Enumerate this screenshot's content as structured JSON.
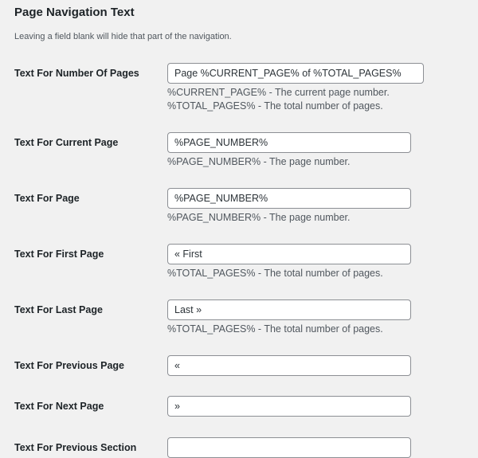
{
  "section": {
    "title": "Page Navigation Text",
    "description": "Leaving a field blank will hide that part of the navigation."
  },
  "fields": [
    {
      "label": "Text For Number Of Pages",
      "value": "Page %CURRENT_PAGE% of %TOTAL_PAGES%",
      "descriptions": [
        "%CURRENT_PAGE% - The current page number.",
        "%TOTAL_PAGES% - The total number of pages."
      ]
    },
    {
      "label": "Text For Current Page",
      "value": "%PAGE_NUMBER%",
      "descriptions": [
        "%PAGE_NUMBER% - The page number."
      ]
    },
    {
      "label": "Text For Page",
      "value": "%PAGE_NUMBER%",
      "descriptions": [
        "%PAGE_NUMBER% - The page number."
      ]
    },
    {
      "label": "Text For First Page",
      "value": "« First",
      "descriptions": [
        "%TOTAL_PAGES% - The total number of pages."
      ]
    },
    {
      "label": "Text For Last Page",
      "value": "Last »",
      "descriptions": [
        "%TOTAL_PAGES% - The total number of pages."
      ]
    },
    {
      "label": "Text For Previous Page",
      "value": "«",
      "descriptions": []
    },
    {
      "label": "Text For Next Page",
      "value": "»",
      "descriptions": []
    },
    {
      "label": "Text For Previous Section",
      "value": "",
      "descriptions": []
    }
  ]
}
